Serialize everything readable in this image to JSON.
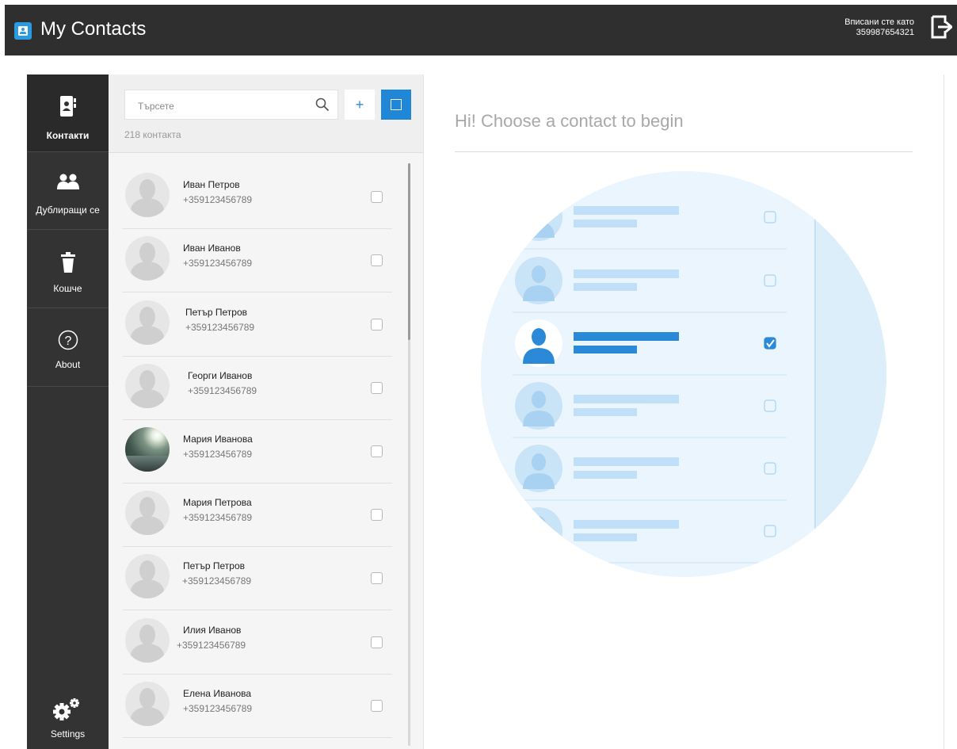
{
  "header": {
    "title": "My Contacts",
    "user_label": "Вписани сте като",
    "user_phone": "359987654321"
  },
  "nav": {
    "items": [
      {
        "label": "Контакти",
        "icon": "address-book-icon",
        "active": true
      },
      {
        "label": "Дублиращи се",
        "icon": "people-icon",
        "active": false
      },
      {
        "label": "Кошче",
        "icon": "trash-icon",
        "active": false
      },
      {
        "label": "About",
        "icon": "help-icon",
        "active": false
      }
    ],
    "settings_label": "Settings"
  },
  "list": {
    "search_placeholder": "Търсете",
    "add_label": "+",
    "count_text": "218 контакта",
    "contacts": [
      {
        "name": "Иван Петров",
        "phone": "+359123456789",
        "photo": false
      },
      {
        "name": "Иван Иванов",
        "phone": "+359123456789",
        "photo": false
      },
      {
        "name": "Петър Петров",
        "phone": "+359123456789",
        "photo": false
      },
      {
        "name": "Георги Иванов",
        "phone": "+359123456789",
        "photo": false
      },
      {
        "name": "Мария Иванова",
        "phone": "+359123456789",
        "photo": true
      },
      {
        "name": "Мария Петрова",
        "phone": "+359123456789",
        "photo": false
      },
      {
        "name": "Петър Петров",
        "phone": "+359123456789",
        "photo": false
      },
      {
        "name": "Илия Иванов",
        "phone": "+359123456789",
        "photo": false
      },
      {
        "name": "Елена Иванова",
        "phone": "+359123456789",
        "photo": false
      }
    ]
  },
  "main": {
    "title": "Hi! Choose a contact to begin"
  },
  "colors": {
    "accent": "#1f87d6",
    "header_bg": "#2f2f2f",
    "nav_bg": "#333333",
    "illustration_bg": "#e3f1fc"
  }
}
